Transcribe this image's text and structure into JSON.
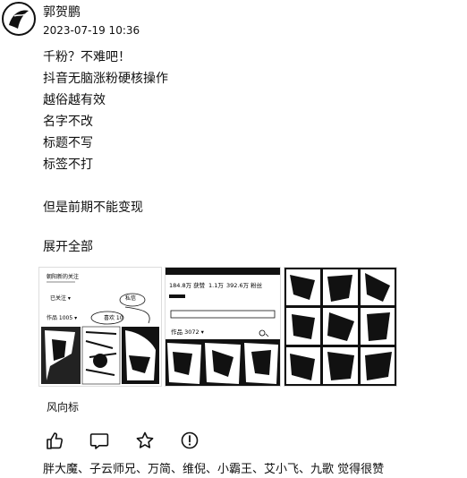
{
  "post": {
    "author": "郭贺鹏",
    "datetime": "2023-07-19 10:36",
    "lines": [
      "千粉？不难吧！",
      "抖音无脑涨粉硬核操作",
      "越俗越有效",
      "名字不改",
      "标题不写",
      "标签不打",
      "",
      "但是前期不能变现"
    ],
    "expand_label": "展开全部",
    "tag": "风向标",
    "liked_by": "胖大魔、子云师兄、万简、维倪、小霸王、艾小飞、九歌 觉得很赞",
    "images": [
      {
        "icon": "profile-screenshot-image",
        "texts": [
          "朝阳新的关注",
          "已关注 ▾",
          "私信",
          "作品 1005 ▾",
          "喜欢 10"
        ]
      },
      {
        "icon": "profile-stats-screenshot-image",
        "texts": [
          "184.8万 获赞",
          "1.1万",
          "392.6万 粉丝",
          "作品 3072 ▾"
        ]
      },
      {
        "icon": "video-grid-screenshot-image"
      }
    ]
  },
  "actions": [
    {
      "icon": "thumbs-up-icon"
    },
    {
      "icon": "comment-icon"
    },
    {
      "icon": "star-icon"
    },
    {
      "icon": "report-icon"
    }
  ]
}
